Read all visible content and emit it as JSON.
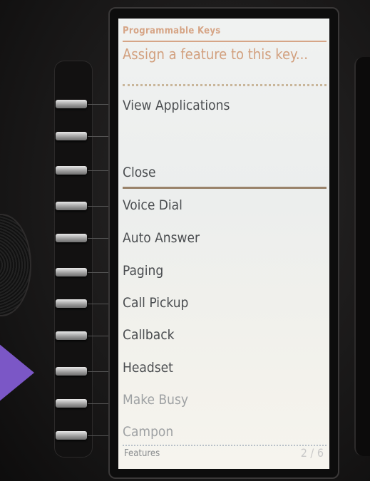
{
  "screen": {
    "header": "Programmable Keys",
    "prompt": "Assign a feature to this key...",
    "top_items": [
      "View Applications",
      "Close"
    ],
    "features": [
      {
        "label": "Voice Dial"
      },
      {
        "label": "Auto Answer"
      },
      {
        "label": "Paging"
      },
      {
        "label": "Call Pickup"
      },
      {
        "label": "Callback"
      },
      {
        "label": "Headset"
      },
      {
        "label": "Make Busy"
      },
      {
        "label": "Campon"
      }
    ],
    "footer_label": "Features",
    "page_indicator": "2 / 6"
  },
  "colors": {
    "accent": "#d6a586",
    "arrow": "#7b57c6",
    "text": "#4a4d50"
  }
}
